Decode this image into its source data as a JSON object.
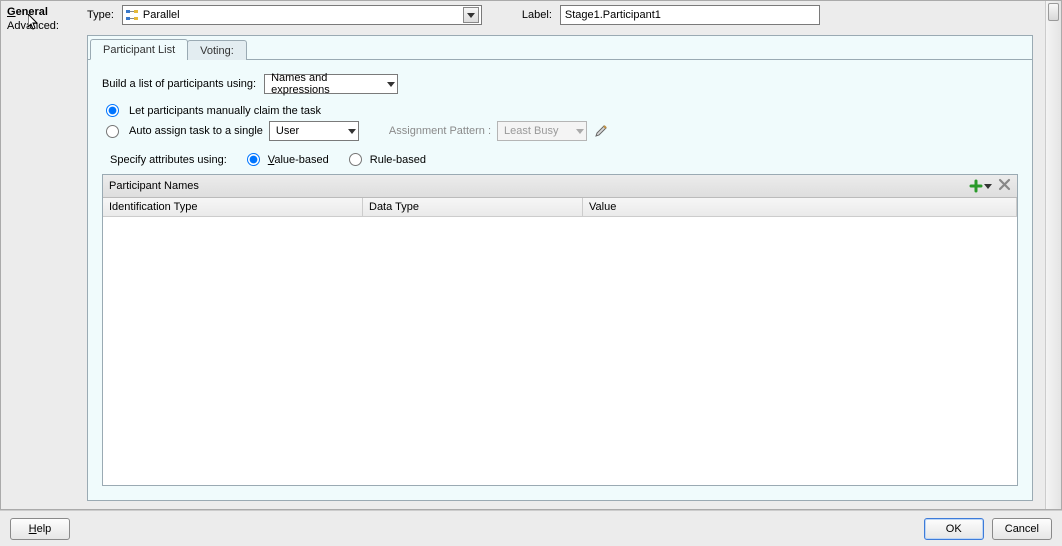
{
  "sidebar": {
    "items": [
      {
        "raw": "General",
        "display_html": "<span class='ul'>G</span>eneral",
        "selected": true
      },
      {
        "raw": "Advanced:",
        "display_html": "Advanced:",
        "selected": false
      }
    ]
  },
  "top": {
    "type_label": "Type:",
    "type_value": "Parallel",
    "label_label": "Label:",
    "label_value": "Stage1.Participant1"
  },
  "tabs": [
    {
      "label": "Participant List",
      "active": true
    },
    {
      "label": "Voting:",
      "active": false
    }
  ],
  "build": {
    "prompt": "Build a list of participants using:",
    "value": "Names and expressions"
  },
  "claim": {
    "manual": "Let participants manually claim the task",
    "auto": "Auto assign task to a single",
    "single_value": "User",
    "pattern_label": "Assignment Pattern :",
    "pattern_value": "Least Busy",
    "selected": "manual"
  },
  "attrs": {
    "prompt": "Specify attributes using:",
    "value_label": "Value-based",
    "rule_label": "Rule-based",
    "selected": "value"
  },
  "grid": {
    "title": "Participant Names",
    "columns": [
      "Identification Type",
      "Data Type",
      "Value"
    ],
    "rows": []
  },
  "footer": {
    "help": "Help",
    "ok": "OK",
    "cancel": "Cancel"
  }
}
